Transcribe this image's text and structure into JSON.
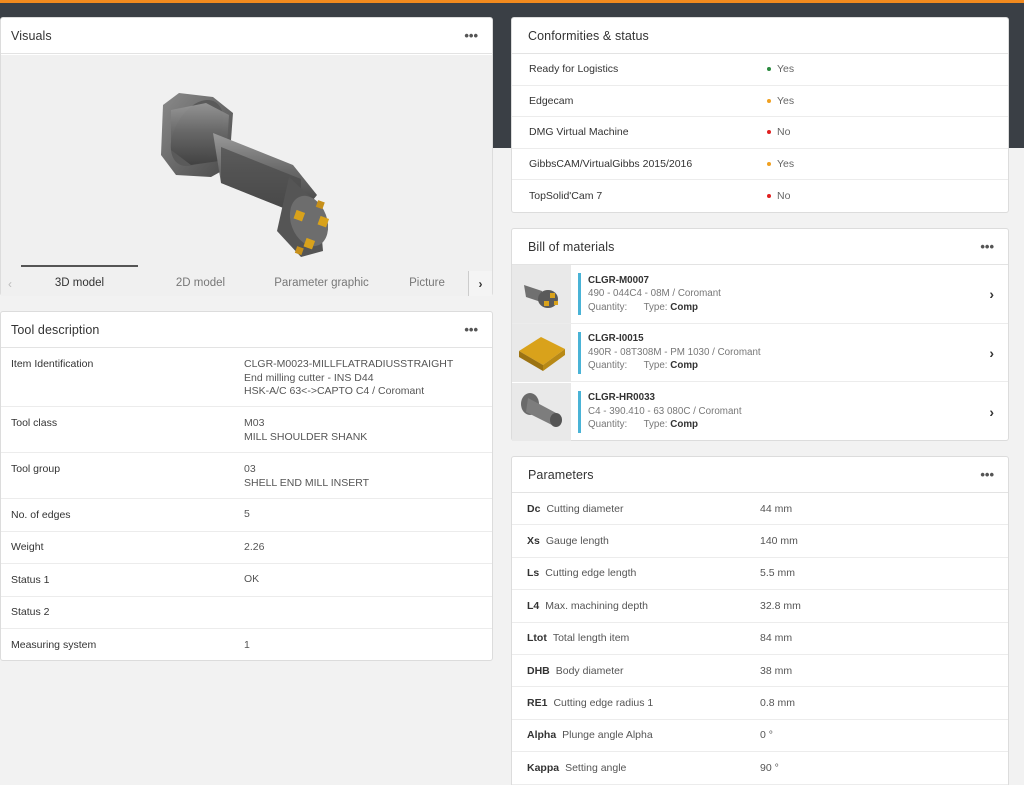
{
  "visuals": {
    "title": "Visuals",
    "more": "•••",
    "tabs": [
      "3D model",
      "2D model",
      "Parameter graphic",
      "Picture"
    ],
    "active_tab": "3D model",
    "left_arrow": "‹",
    "right_arrow": "›"
  },
  "tool_description": {
    "title": "Tool description",
    "more": "•••",
    "rows": [
      {
        "key": "Item Identification",
        "lines": [
          "CLGR-M0023-MILLFLATRADIUSSTRAIGHT",
          "End milling cutter - INS D44",
          "HSK-A/C 63<->CAPTO C4 / Coromant"
        ]
      },
      {
        "key": "Tool class",
        "lines": [
          "M03",
          "MILL SHOULDER SHANK"
        ]
      },
      {
        "key": "Tool group",
        "lines": [
          "03",
          "SHELL END MILL INSERT"
        ]
      },
      {
        "key": "No. of edges",
        "lines": [
          "5"
        ]
      },
      {
        "key": "Weight",
        "lines": [
          "2.26"
        ]
      },
      {
        "key": "Status 1",
        "lines": [
          "OK"
        ]
      },
      {
        "key": "Status 2",
        "lines": [
          ""
        ]
      },
      {
        "key": "Measuring system",
        "lines": [
          "1"
        ]
      }
    ]
  },
  "conformities": {
    "title": "Conformities & status",
    "rows": [
      {
        "label": "Ready for Logistics",
        "status": "Yes",
        "color": "#2a8a3e"
      },
      {
        "label": "Edgecam",
        "status": "Yes",
        "color": "#f0a020"
      },
      {
        "label": "DMG Virtual Machine",
        "status": "No",
        "color": "#e02020"
      },
      {
        "label": "GibbsCAM/VirtualGibbs 2015/2016",
        "status": "Yes",
        "color": "#f0a020"
      },
      {
        "label": "TopSolid'Cam 7",
        "status": "No",
        "color": "#e02020"
      }
    ]
  },
  "bom": {
    "title": "Bill of materials",
    "more": "•••",
    "items": [
      {
        "id": "CLGR-M0007",
        "desc": "490 - 044C4 - 08M / Coromant",
        "quantity_label": "Quantity:",
        "type_label": "Type:",
        "type": "Comp",
        "thumb": "milling-cutter-icon"
      },
      {
        "id": "CLGR-I0015",
        "desc": "490R - 08T308M - PM 1030 / Coromant",
        "quantity_label": "Quantity:",
        "type_label": "Type:",
        "type": "Comp",
        "thumb": "insert-icon"
      },
      {
        "id": "CLGR-HR0033",
        "desc": "C4 - 390.410 - 63 080C / Coromant",
        "quantity_label": "Quantity:",
        "type_label": "Type:",
        "type": "Comp",
        "thumb": "tool-holder-icon"
      }
    ],
    "chevron": "›"
  },
  "parameters": {
    "title": "Parameters",
    "more": "•••",
    "rows": [
      {
        "code": "Dc",
        "name": "Cutting diameter",
        "value": "44 mm"
      },
      {
        "code": "Xs",
        "name": "Gauge length",
        "value": "140 mm"
      },
      {
        "code": "Ls",
        "name": "Cutting edge length",
        "value": "5.5 mm"
      },
      {
        "code": "L4",
        "name": "Max. machining depth",
        "value": "32.8 mm"
      },
      {
        "code": "Ltot",
        "name": "Total length item",
        "value": "84 mm"
      },
      {
        "code": "DHB",
        "name": "Body diameter",
        "value": "38 mm"
      },
      {
        "code": "RE1",
        "name": "Cutting edge radius 1",
        "value": "0.8 mm"
      },
      {
        "code": "Alpha",
        "name": "Plunge angle Alpha",
        "value": "0 °"
      },
      {
        "code": "Kappa",
        "name": "Setting angle",
        "value": "90 °"
      }
    ]
  },
  "colors": {
    "accent": "#f28a1e",
    "header_band": "#3a3f45",
    "bom_bar": "#4ab3d6",
    "insert_gold": "#d9a21b"
  }
}
